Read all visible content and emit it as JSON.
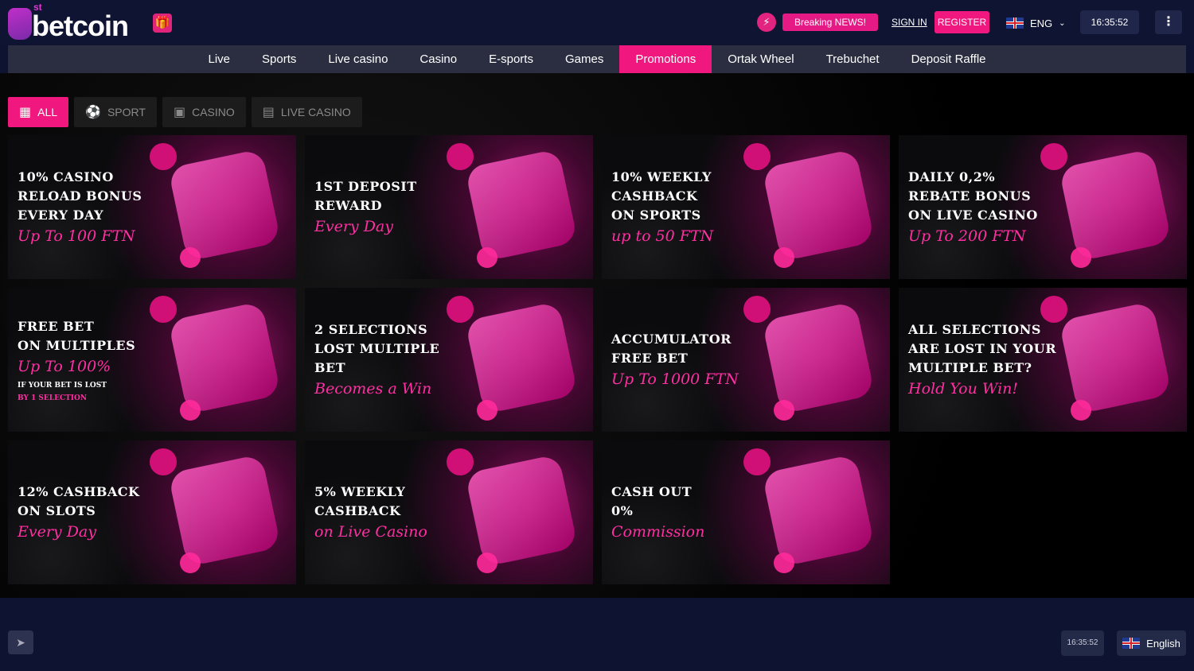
{
  "header": {
    "logo_superscript": "st",
    "logo_text": "betcoin",
    "breaking_news": "Breaking NEWS!",
    "sign_in": "SIGN IN",
    "register": "REGISTER",
    "language": "ENG",
    "time": "16:35:52"
  },
  "nav": {
    "items": [
      "Live",
      "Sports",
      "Live casino",
      "Casino",
      "E-sports",
      "Games",
      "Promotions",
      "Ortak Wheel",
      "Trebuchet",
      "Deposit Raffle"
    ],
    "active_index": 6
  },
  "filters": [
    {
      "label": "ALL",
      "icon": "grid-icon",
      "active": true
    },
    {
      "label": "SPORT",
      "icon": "sport-icon",
      "active": false
    },
    {
      "label": "CASINO",
      "icon": "slots-icon",
      "active": false
    },
    {
      "label": "LIVE CASINO",
      "icon": "live-casino-icon",
      "active": false
    }
  ],
  "promotions": [
    {
      "lines": [
        "10% Casino",
        "Reload Bonus",
        "Every Day"
      ],
      "accent": "Up To 100 FTN",
      "note": ""
    },
    {
      "lines": [
        "1st Deposit",
        "Reward"
      ],
      "accent": "Every Day",
      "note": ""
    },
    {
      "lines": [
        "10% Weekly",
        "Cashback",
        "on Sports"
      ],
      "accent": "up to 50 FTN",
      "note": ""
    },
    {
      "lines": [
        "Daily 0,2%",
        "Rebate Bonus",
        "on Live Casino"
      ],
      "accent": "Up To 200 FTN",
      "note": ""
    },
    {
      "lines": [
        "Free Bet",
        "on Multiples"
      ],
      "accent": "Up To 100%",
      "note": "If your bet is lost",
      "note2": "by 1 selection"
    },
    {
      "lines": [
        "2 Selections",
        "Lost Multiple Bet"
      ],
      "accent": "Becomes a Win",
      "note": ""
    },
    {
      "lines": [
        "Accumulator",
        "Free Bet"
      ],
      "accent": "Up To 1000 FTN",
      "note": ""
    },
    {
      "lines": [
        "All Selections",
        "are Lost in Your",
        "Multiple Bet?"
      ],
      "accent": "Hold You Win!",
      "note": ""
    },
    {
      "lines": [
        "12% Cashback",
        "on Slots"
      ],
      "accent": "Every Day",
      "note": ""
    },
    {
      "lines": [
        "5% Weekly",
        "Cashback"
      ],
      "accent": "on Live Casino",
      "note": ""
    },
    {
      "lines": [
        "Cash Out",
        "0%"
      ],
      "accent": "Commission",
      "note": ""
    }
  ],
  "footer": {
    "time": "16:35:52",
    "language": "English"
  },
  "colors": {
    "accent": "#f0187f",
    "header_bg": "#0e1431",
    "nav_bg": "#2a2e40",
    "content_bg": "#000000"
  }
}
